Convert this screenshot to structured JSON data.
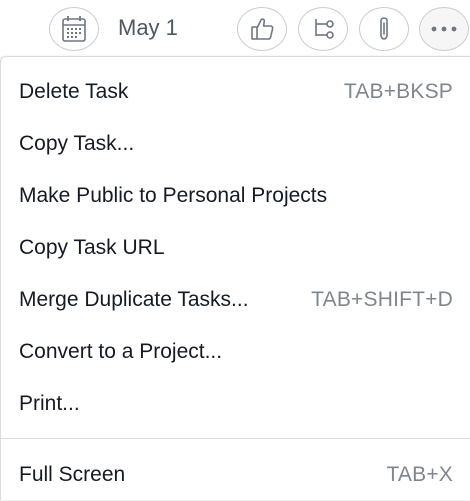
{
  "toolbar": {
    "due_date": "May 1",
    "icons": {
      "due_date": "calendar-icon",
      "like": "thumbs-up-icon",
      "subtasks": "subtask-branch-icon",
      "attach": "paperclip-icon",
      "more": "more-horizontal-icon"
    }
  },
  "menu": {
    "items": [
      {
        "label": "Delete Task",
        "shortcut": "TAB+BKSP"
      },
      {
        "label": "Copy Task...",
        "shortcut": ""
      },
      {
        "label": "Make Public to Personal Projects",
        "shortcut": ""
      },
      {
        "label": "Copy Task URL",
        "shortcut": ""
      },
      {
        "label": "Merge Duplicate Tasks...",
        "shortcut": "TAB+SHIFT+D"
      },
      {
        "label": "Convert to a Project...",
        "shortcut": ""
      },
      {
        "label": "Print...",
        "shortcut": ""
      },
      {
        "label": "Full Screen",
        "shortcut": "TAB+X"
      }
    ]
  },
  "colors": {
    "text": "#151b26",
    "shortcut": "#80868e",
    "border": "#c9ccd1",
    "divider": "#dcdee1"
  }
}
